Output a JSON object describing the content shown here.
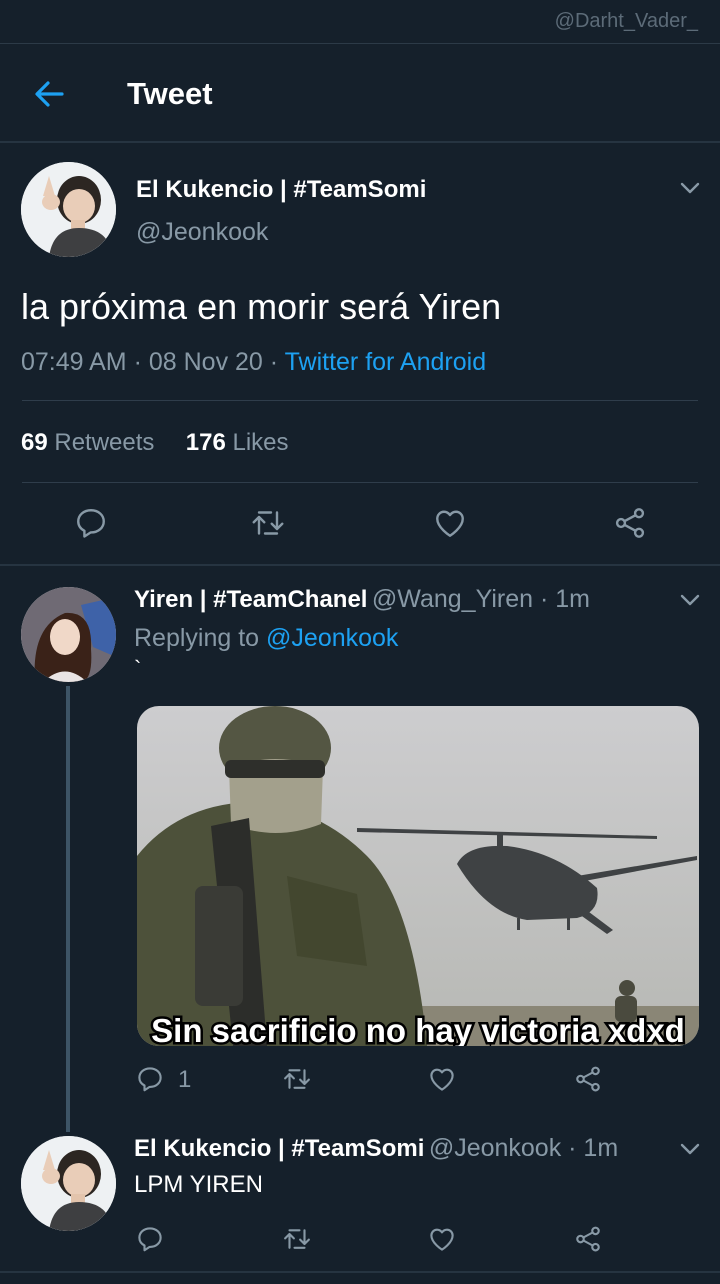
{
  "watermark": "@Darht_Vader_",
  "header": {
    "title": "Tweet"
  },
  "main_tweet": {
    "author_name": "El Kukencio | #TeamSomi",
    "handle": "@Jeonkook",
    "text": "la próxima en morir será Yiren",
    "time": "07:49 AM",
    "date": "08 Nov 20",
    "dot": "·",
    "source": "Twitter for Android",
    "retweets_count": "69",
    "retweets_label": "Retweets",
    "likes_count": "176",
    "likes_label": "Likes"
  },
  "reply1": {
    "author_name": "Yiren | #TeamChanel",
    "handle_time": "@Wang_Yiren · 1m",
    "replying_prefix": "Replying to",
    "replying_handle": "@Jeonkook",
    "text": "`",
    "image_caption": "Sin sacrificio no hay victoria xdxd",
    "reply_count": "1"
  },
  "reply2": {
    "author_name": "El Kukencio | #TeamSomi",
    "handle_time": "@Jeonkook · 1m",
    "text": "LPM YIREN"
  },
  "icons": [
    "back-arrow-icon",
    "chevron-down-icon",
    "reply-icon",
    "retweet-icon",
    "like-icon",
    "share-icon"
  ],
  "colors": {
    "background": "#15202b",
    "accent": "#1da1f2",
    "muted": "#8899a6"
  }
}
